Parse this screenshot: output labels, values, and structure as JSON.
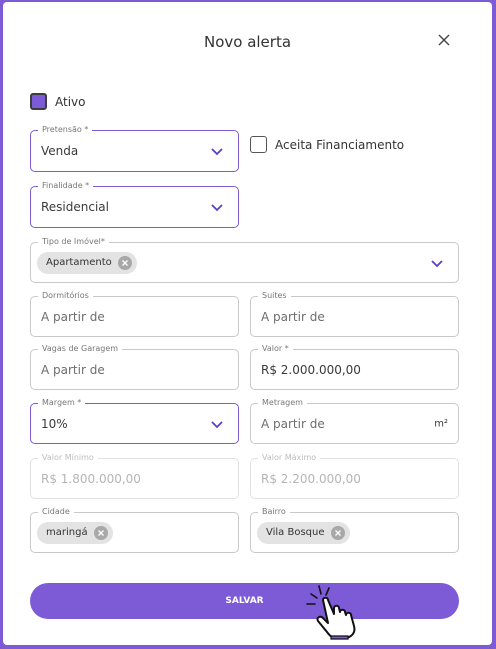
{
  "dialog": {
    "title": "Novo alerta"
  },
  "ativo": {
    "label": "Ativo",
    "checked": true
  },
  "aceita_financiamento": {
    "label": "Aceita Financiamento",
    "checked": false
  },
  "pretensao": {
    "label": "Pretensão *",
    "value": "Venda"
  },
  "finalidade": {
    "label": "Finalidade *",
    "value": "Residencial"
  },
  "tipo_imovel": {
    "label": "Tipo de Imóvel*",
    "chips": [
      "Apartamento"
    ]
  },
  "dormitorios": {
    "label": "Dormitórios",
    "placeholder": "A partir de"
  },
  "suites": {
    "label": "Suites",
    "placeholder": "A partir de"
  },
  "vagas": {
    "label": "Vagas de Garagem",
    "placeholder": "A partir de"
  },
  "valor": {
    "label": "Valor *",
    "value": "R$ 2.000.000,00"
  },
  "margem": {
    "label": "Margem *",
    "value": "10%"
  },
  "metragem": {
    "label": "Metragem",
    "placeholder": "A partir de",
    "unit": "m²"
  },
  "valor_minimo": {
    "label": "Valor Mínimo",
    "value": "R$ 1.800.000,00"
  },
  "valor_maximo": {
    "label": "Valor Máximo",
    "value": "R$ 2.200.000,00"
  },
  "cidade": {
    "label": "Cidade",
    "chips": [
      "maringá"
    ]
  },
  "bairro": {
    "label": "Bairro",
    "chips": [
      "Vila Bosque"
    ]
  },
  "save_button": {
    "label": "SALVAR"
  },
  "colors": {
    "accent": "#7d5bd6",
    "border": "#c9c9c9",
    "chip": "#e3e3e3"
  },
  "icons": [
    "close-icon",
    "chevron-down-icon",
    "chip-remove-icon",
    "checkbox-icon",
    "pointer-hand-icon"
  ]
}
